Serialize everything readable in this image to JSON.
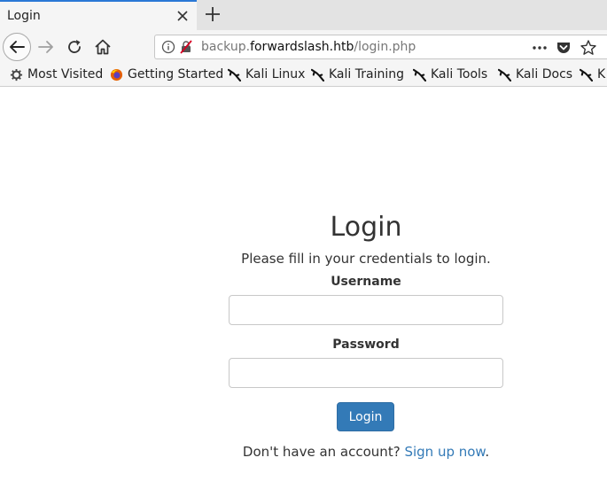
{
  "tab": {
    "title": "Login"
  },
  "url": {
    "prefix": "backup.",
    "domain": "forwardslash.htb",
    "path": "/login.php"
  },
  "bookmarks": [
    {
      "label": "Most Visited",
      "icon": "gear-icon"
    },
    {
      "label": "Getting Started",
      "icon": "firefox-icon"
    },
    {
      "label": "Kali Linux",
      "icon": "kali-dragon-icon"
    },
    {
      "label": "Kali Training",
      "icon": "kali-dragon-icon"
    },
    {
      "label": "Kali Tools",
      "icon": "kali-dragon-icon"
    },
    {
      "label": "Kali Docs",
      "icon": "kali-dragon-icon"
    },
    {
      "label": "K",
      "icon": "kali-dragon-icon"
    }
  ],
  "page": {
    "title": "Login",
    "subtitle": "Please fill in your credentials to login.",
    "username_label": "Username",
    "username_value": "",
    "password_label": "Password",
    "password_value": "",
    "submit_label": "Login",
    "signup_prompt": "Don't have an account?",
    "signup_link": "Sign up now",
    "signup_suffix": "."
  },
  "colors": {
    "accent": "#337ab7",
    "tab_highlight": "#2a78d6"
  }
}
